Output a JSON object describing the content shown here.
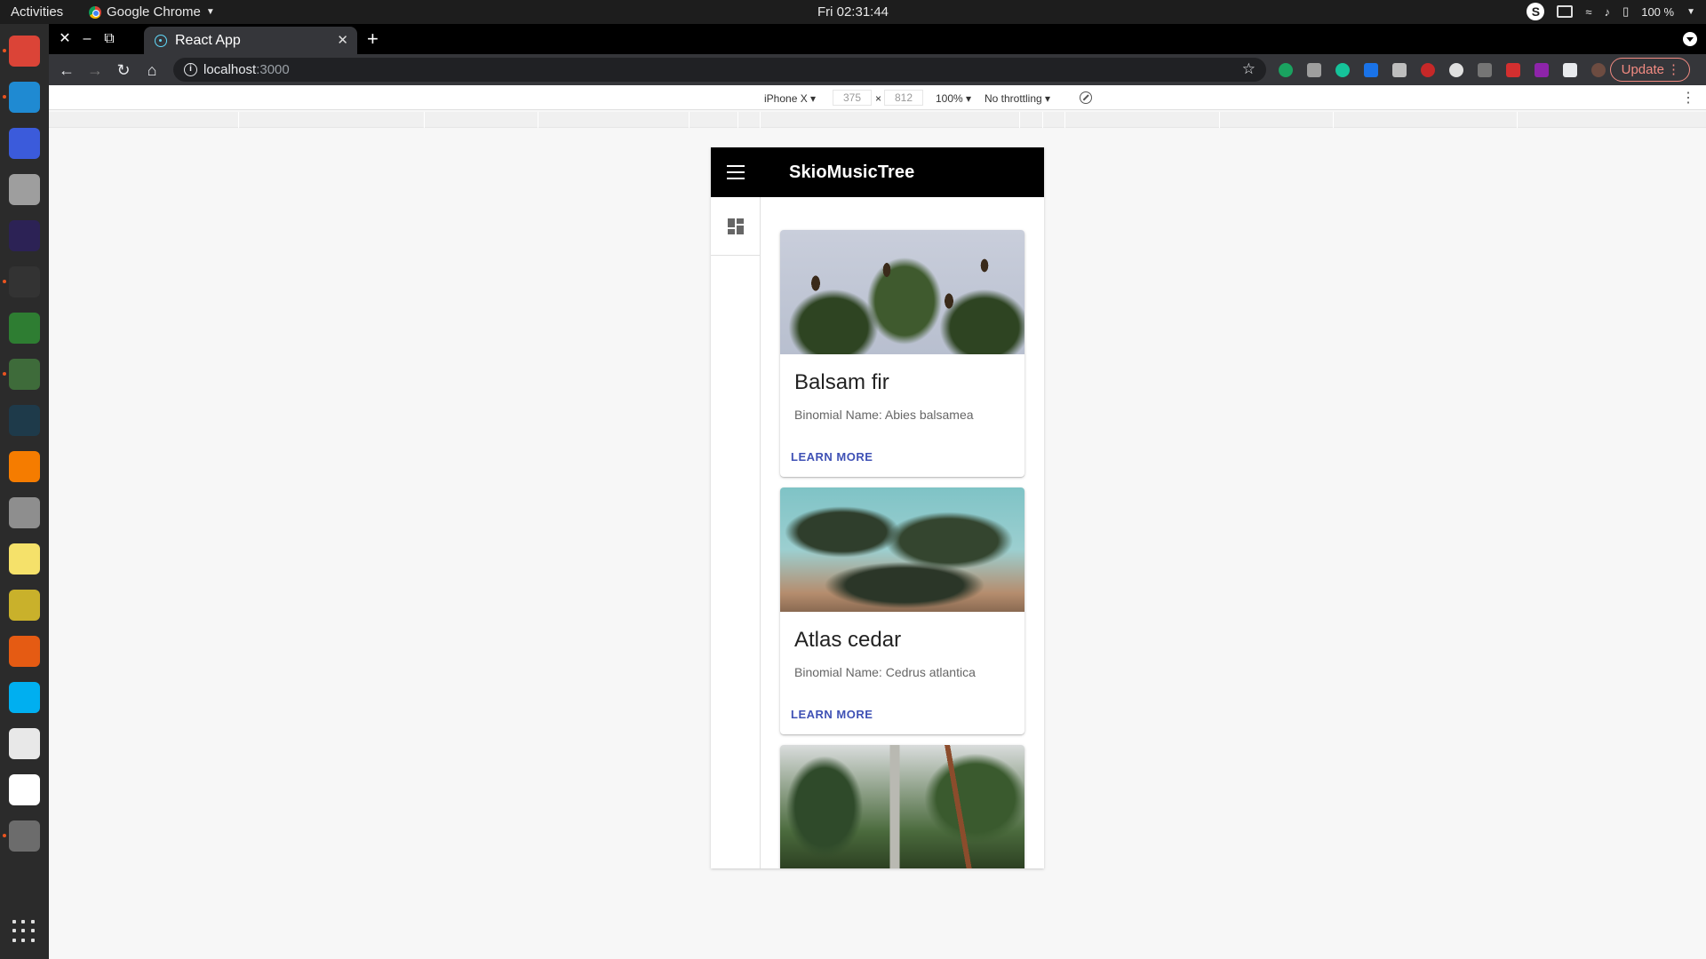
{
  "system_bar": {
    "activities": "Activities",
    "app_name": "Google Chrome",
    "clock": "Fri 02:31:44",
    "battery": "100 %"
  },
  "dock": {
    "items": [
      {
        "name": "chrome-icon",
        "color": "#db4437"
      },
      {
        "name": "vscode-icon",
        "color": "#1f8ad2"
      },
      {
        "name": "remote-desktop-icon",
        "color": "#3b5bdb"
      },
      {
        "name": "files-icon",
        "color": "#9e9e9e"
      },
      {
        "name": "eclipse-icon",
        "color": "#2c2255"
      },
      {
        "name": "terminal-icon",
        "color": "#333333"
      },
      {
        "name": "robo3t-icon",
        "color": "#2e7d32"
      },
      {
        "name": "sqlite-icon",
        "color": "#3e6b3a"
      },
      {
        "name": "system-monitor-icon",
        "color": "#1e3a4a"
      },
      {
        "name": "vlc-icon",
        "color": "#f57c00"
      },
      {
        "name": "settings-icon",
        "color": "#8e8e8e"
      },
      {
        "name": "notes-icon",
        "color": "#f5e16a"
      },
      {
        "name": "ruler-icon",
        "color": "#c9b12b"
      },
      {
        "name": "firefox-icon",
        "color": "#e55b13"
      },
      {
        "name": "skype-icon",
        "color": "#00aff0"
      },
      {
        "name": "charts-icon",
        "color": "#e8e8e8"
      },
      {
        "name": "code-editor-icon",
        "color": "#ffffff"
      },
      {
        "name": "software-updater-icon",
        "color": "#6c6c6c"
      }
    ]
  },
  "browser": {
    "tab_title": "React App",
    "url_host": "localhost",
    "url_port": ":3000",
    "update_label": "Update"
  },
  "devtools": {
    "device": "iPhone X",
    "width": "375",
    "times": "×",
    "height": "812",
    "zoom": "100%",
    "throttling": "No throttling"
  },
  "app": {
    "title": "SkioMusicTree",
    "cards": [
      {
        "title": "Balsam fir",
        "subtitle": "Binomial Name: Abies balsamea",
        "action": "LEARN MORE"
      },
      {
        "title": "Atlas cedar",
        "subtitle": "Binomial Name: Cedrus atlantica",
        "action": "LEARN MORE"
      }
    ]
  }
}
